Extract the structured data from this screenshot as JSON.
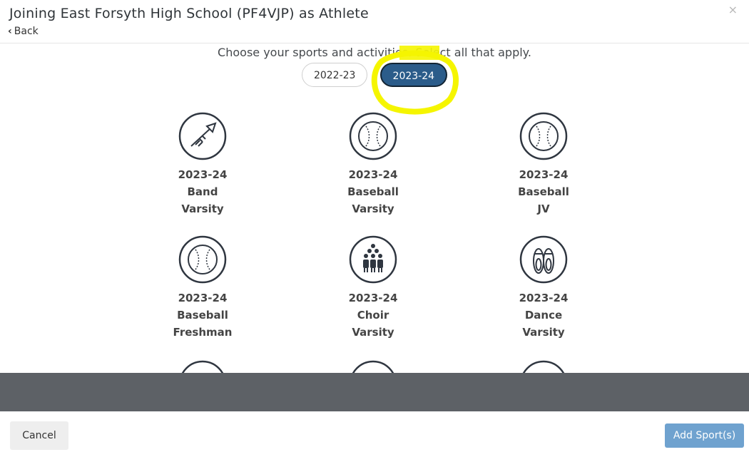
{
  "header": {
    "title": "Joining East Forsyth High School (PF4VJP) as Athlete",
    "back_label": "Back",
    "close_symbol": "×"
  },
  "instructions": "Choose your sports and activities. Select all that apply.",
  "years": [
    {
      "label": "2022-23",
      "selected": false
    },
    {
      "label": "2023-24",
      "selected": true
    }
  ],
  "activities": [
    {
      "year": "2023-24",
      "sport": "Band",
      "level": "Varsity",
      "icon": "trumpet-icon"
    },
    {
      "year": "2023-24",
      "sport": "Baseball",
      "level": "Varsity",
      "icon": "baseball-icon"
    },
    {
      "year": "2023-24",
      "sport": "Baseball",
      "level": "JV",
      "icon": "baseball-icon"
    },
    {
      "year": "2023-24",
      "sport": "Baseball",
      "level": "Freshman",
      "icon": "baseball-icon"
    },
    {
      "year": "2023-24",
      "sport": "Choir",
      "level": "Varsity",
      "icon": "choir-icon"
    },
    {
      "year": "2023-24",
      "sport": "Dance",
      "level": "Varsity",
      "icon": "ballet-shoes-icon"
    }
  ],
  "footer": {
    "cancel_label": "Cancel",
    "add_label": "Add Sport(s)"
  },
  "colors": {
    "selected_pill": "#2b5c8a",
    "add_button": "#6fa2cf",
    "annotation_highlight": "#f5f500",
    "band": "#5d6166"
  }
}
